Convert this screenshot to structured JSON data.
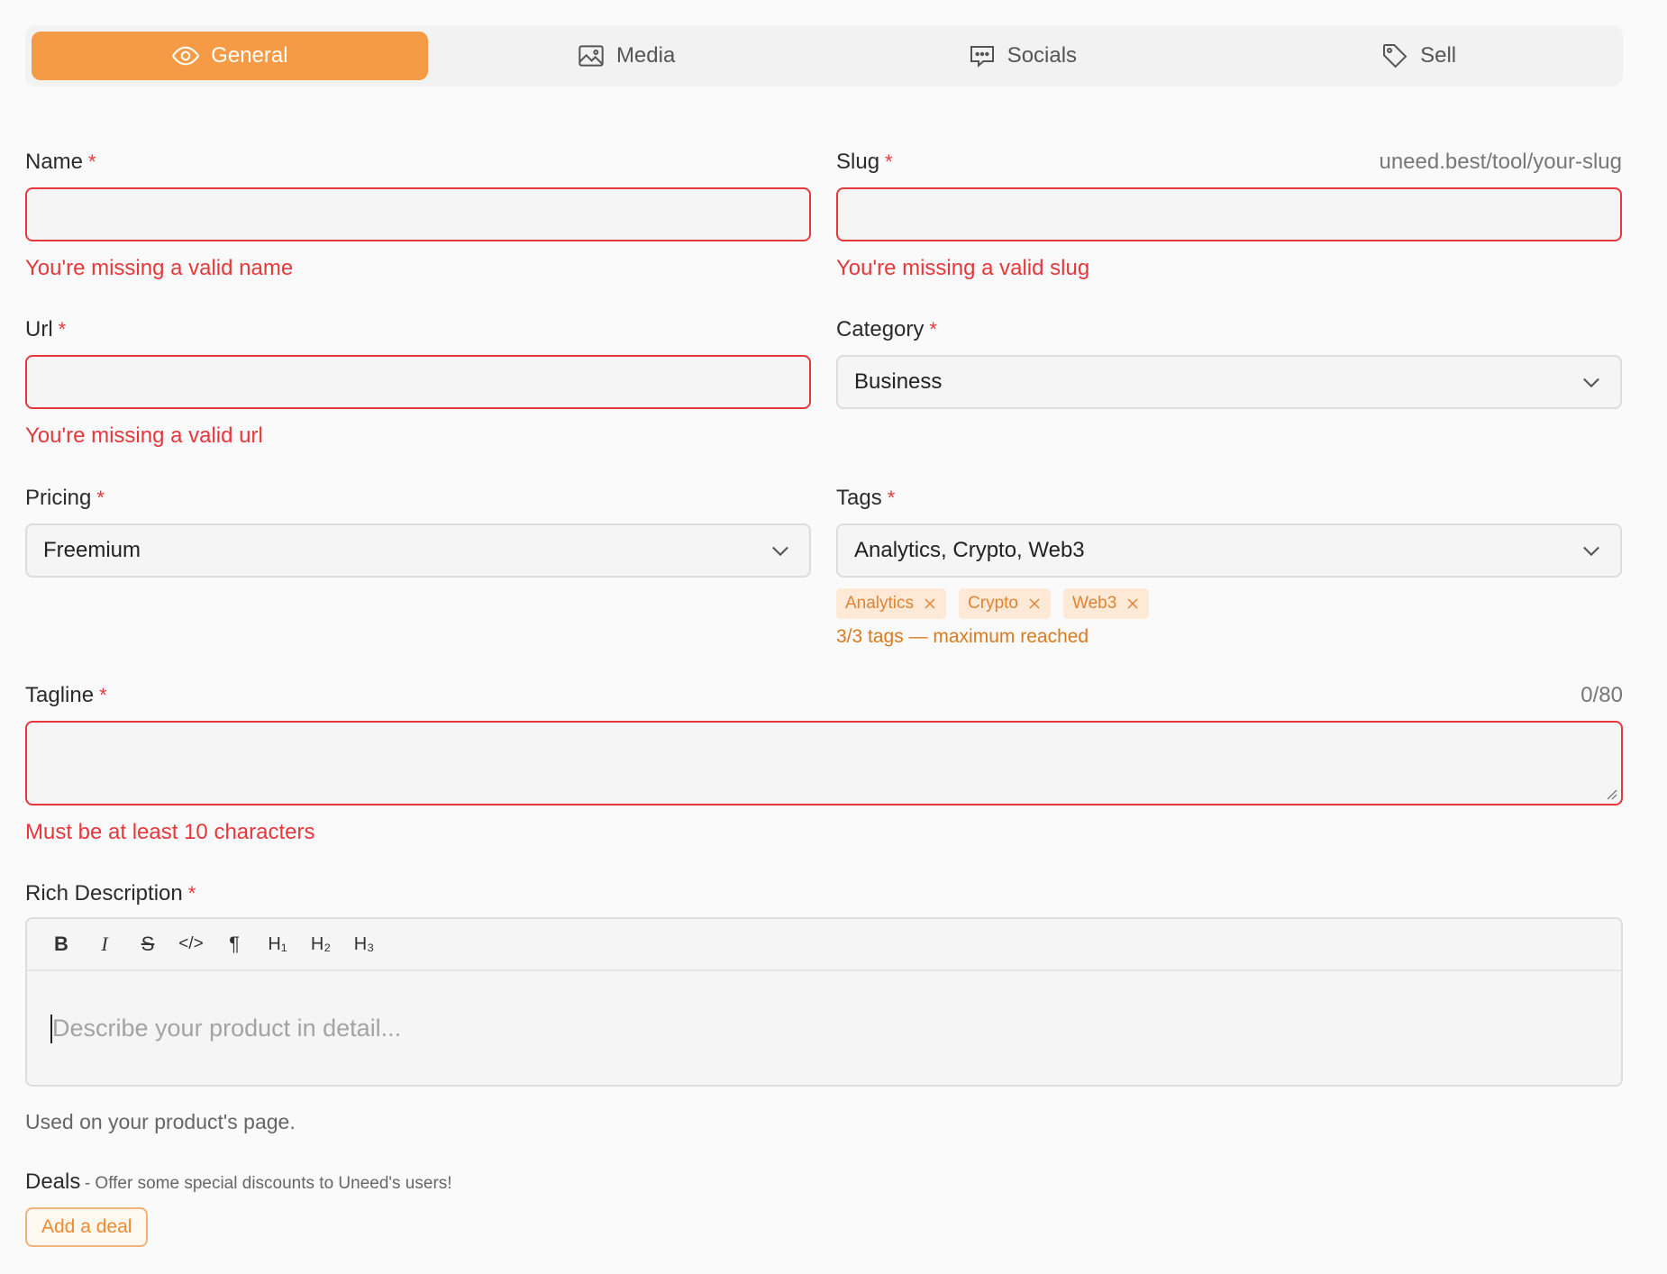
{
  "tabs": [
    {
      "label": "General",
      "icon": "eye-icon",
      "active": true
    },
    {
      "label": "Media",
      "icon": "image-icon",
      "active": false
    },
    {
      "label": "Socials",
      "icon": "chat-icon",
      "active": false
    },
    {
      "label": "Sell",
      "icon": "tag-icon",
      "active": false
    }
  ],
  "required_mark": "*",
  "fields": {
    "name": {
      "label": "Name",
      "error": "You're missing a valid name",
      "value": ""
    },
    "slug": {
      "label": "Slug",
      "hint": "uneed.best/tool/your-slug",
      "error": "You're missing a valid slug",
      "value": ""
    },
    "url": {
      "label": "Url",
      "error": "You're missing a valid url",
      "value": ""
    },
    "category": {
      "label": "Category",
      "value": "Business"
    },
    "pricing": {
      "label": "Pricing",
      "value": "Freemium"
    },
    "tags": {
      "label": "Tags",
      "value": "Analytics, Crypto, Web3",
      "chips": [
        "Analytics",
        "Crypto",
        "Web3"
      ],
      "limit_text": "3/3 tags — maximum reached"
    },
    "tagline": {
      "label": "Tagline",
      "counter": "0/80",
      "error": "Must be at least 10 characters",
      "value": ""
    },
    "description": {
      "label": "Rich Description",
      "placeholder": "Describe your product in detail...",
      "help": "Used on your product's page.",
      "toolbar": [
        "B",
        "I",
        "S",
        "</>",
        "¶",
        "H₁",
        "H₂",
        "H₃"
      ]
    }
  },
  "deals": {
    "title": "Deals",
    "subtitle": "- Offer some special discounts to Uneed's users!",
    "button": "Add a deal"
  },
  "colors": {
    "accent": "#f59a45",
    "error": "#e5383b",
    "tag_bg": "#fde9d6"
  }
}
